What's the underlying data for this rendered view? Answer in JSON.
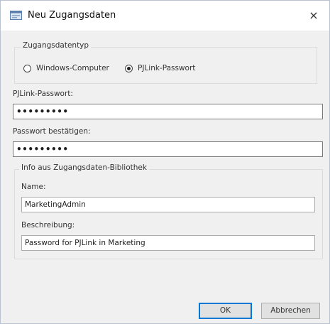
{
  "window": {
    "title": "Neu Zugangsdaten",
    "app_icon": "dialog-window-icon",
    "close_glyph": "×"
  },
  "type_group": {
    "legend": "Zugangsdatentyp",
    "options": [
      {
        "label": "Windows-Computer",
        "selected": false
      },
      {
        "label": "PJLink-Passwort",
        "selected": true
      }
    ]
  },
  "password": {
    "label": "PJLink-Passwort:",
    "value": "•••••••••"
  },
  "confirm": {
    "label": "Passwort bestätigen:",
    "value": "•••••••••"
  },
  "library": {
    "legend": "Info aus Zugangsdaten-Bibliothek",
    "name_label": "Name:",
    "name_value": "MarketingAdmin",
    "description_label": "Beschreibung:",
    "description_value": "Password for PJLink in Marketing"
  },
  "buttons": {
    "ok": "OK",
    "cancel": "Abbrechen"
  },
  "colors": {
    "focus_accent": "#0078d7",
    "dialog_background": "#f0f0f0"
  }
}
